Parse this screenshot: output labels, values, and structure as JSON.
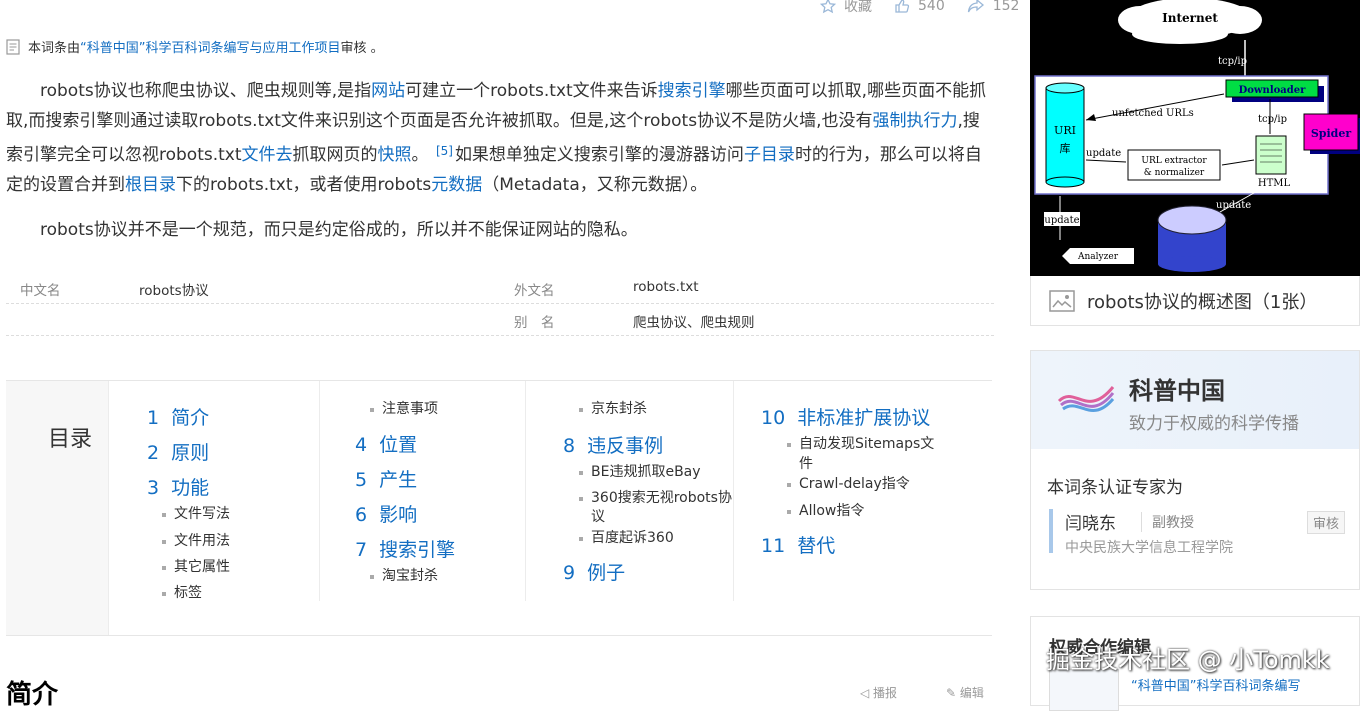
{
  "actions": {
    "collect": "收藏",
    "like_count": "540",
    "share_count": "152"
  },
  "review": {
    "prefix": "本词条由",
    "project": "“科普中国”科学百科词条编写与应用工作项目",
    "suffix": " 审核 。"
  },
  "intro": {
    "p1_a": "robots协议也称爬虫协议、爬虫规则等,是指",
    "p1_link1": "网站",
    "p1_b": "可建立一个robots.txt文件来告诉",
    "p1_link2": "搜索引擎",
    "p1_c": "哪些页面可以抓取,哪些页面不能抓取,而搜索引擎则通过读取robots.txt文件来识别这个页面是否允许被抓取。但是,这个robots协议不是防火墙,也没有",
    "p1_link3": "强制执行力",
    "p1_d": ",搜索引擎完全可以忽视robots.txt",
    "p1_link4": "文件去",
    "p1_e": "抓取网页的",
    "p1_link5": "快照",
    "p1_f": "。 ",
    "p1_ref": "[5]",
    "p1_g": "如果想单独定义搜索引擎的漫游器访问",
    "p1_link6": "子目录",
    "p1_h": "时的行为，那么可以将自定的设置合并到",
    "p1_link7": "根目录",
    "p1_i": "下的robots.txt，或者使用robots",
    "p1_link8": "元数据",
    "p1_j": "（Metadata，又称元数据）。",
    "p2": "robots协议并不是一个规范，而只是约定俗成的，所以并不能保证网站的隐私。"
  },
  "basic_info": {
    "zh_label": "中文名",
    "zh_value": "robots协议",
    "en_label": "外文名",
    "en_value": "robots.txt",
    "alias_label": "别　名",
    "alias_value": "爬虫协议、爬虫规则"
  },
  "catalog": {
    "title": "目录",
    "col1": [
      {
        "n": "1",
        "t": "简介"
      },
      {
        "n": "2",
        "t": "原则"
      },
      {
        "n": "3",
        "t": "功能",
        "subs": [
          "文件写法",
          "文件用法",
          "其它属性",
          "标签"
        ]
      }
    ],
    "col2_top_sub": "注意事项",
    "col2": [
      {
        "n": "4",
        "t": "位置"
      },
      {
        "n": "5",
        "t": "产生"
      },
      {
        "n": "6",
        "t": "影响"
      },
      {
        "n": "7",
        "t": "搜索引擎",
        "subs": [
          "淘宝封杀"
        ]
      }
    ],
    "col3_top_sub": "京东封杀",
    "col3": [
      {
        "n": "8",
        "t": "违反事例",
        "subs": [
          "BE违规抓取eBay",
          "360搜索无视robots协",
          "议",
          "百度起诉360"
        ]
      },
      {
        "n": "9",
        "t": "例子"
      }
    ],
    "col4": [
      {
        "n": "10",
        "t": "非标准扩展协议",
        "subs": [
          "自动发现Sitemaps文",
          "件",
          "Crawl-delay指令",
          "Allow指令"
        ]
      },
      {
        "n": "11",
        "t": "替代"
      }
    ]
  },
  "next_section": {
    "heading": "简介",
    "edit1": "播报",
    "edit2": "编辑"
  },
  "diagram": {
    "internet": "Internet",
    "tcpip1": "tcp/ip",
    "downloader": "Downloader",
    "tcpip2": "tcp/ip",
    "spider": "Spider",
    "unfetched": "unfetched URLs",
    "uri_lib1": "URI",
    "uri_lib2": "库",
    "update1": "update",
    "extractor1": "URL extractor",
    "extractor2": "& normalizer",
    "html": "HTML",
    "update2": "update",
    "update3": "update",
    "analyzer": "Analyzer"
  },
  "album": {
    "caption": "robots协议的概述图（1张）"
  },
  "kepu_card": {
    "brand": "科普中国",
    "slogan": "致力于权威的科学传播",
    "cert_label": "本词条认证专家为",
    "expert_name": "闫晓东",
    "expert_title": "副教授",
    "tag": "审核",
    "expert_org": "中央民族大学信息工程学院"
  },
  "authority_card": {
    "title": "权威合作编辑",
    "sub": "“科普中国”科学百科词条编写"
  },
  "watermark": "掘金技术社区 @ 小Tomkk",
  "colors": {
    "link": "#136ec2",
    "accent_green": "#00cc33",
    "spider_pink": "#ff00cc"
  }
}
